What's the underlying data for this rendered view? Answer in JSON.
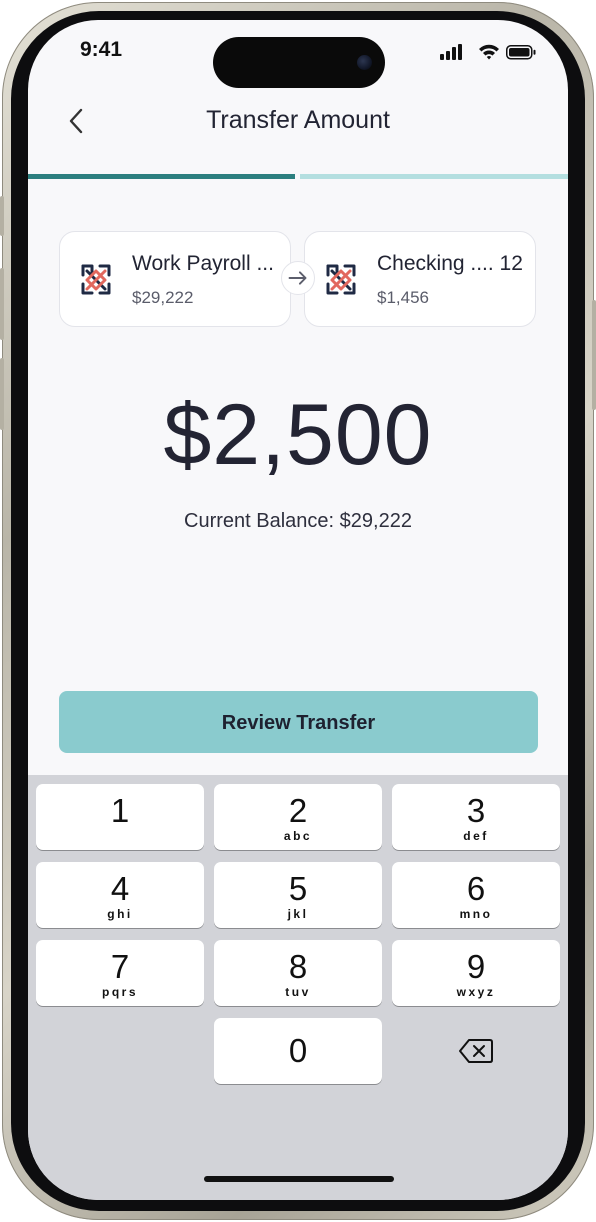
{
  "status_bar": {
    "time": "9:41"
  },
  "header": {
    "title": "Transfer Amount",
    "back_icon": "chevron-left-icon"
  },
  "progress": {
    "step": 1,
    "total_steps": 2
  },
  "accounts": {
    "from": {
      "name": "Work Payroll ...",
      "balance": "$29,222",
      "icon": "bank-logo-icon"
    },
    "to": {
      "name": "Checking .... 12",
      "balance": "$1,456",
      "icon": "bank-logo-icon"
    },
    "arrow_icon": "arrow-right-icon"
  },
  "amount": "$2,500",
  "current_balance": "Current Balance: $29,222",
  "review_button": "Review Transfer",
  "keypad": {
    "keys": [
      {
        "digit": "1",
        "letters": ""
      },
      {
        "digit": "2",
        "letters": "abc"
      },
      {
        "digit": "3",
        "letters": "def"
      },
      {
        "digit": "4",
        "letters": "ghi"
      },
      {
        "digit": "5",
        "letters": "jkl"
      },
      {
        "digit": "6",
        "letters": "mno"
      },
      {
        "digit": "7",
        "letters": "pqrs"
      },
      {
        "digit": "8",
        "letters": "tuv"
      },
      {
        "digit": "9",
        "letters": "wxyz"
      },
      {
        "digit": "0",
        "letters": ""
      }
    ],
    "delete_icon": "backspace-icon"
  },
  "colors": {
    "accent": "#2c7f7f",
    "accent_light": "#b4dfe0",
    "button": "#8acbce",
    "logo_navy": "#1f2a44",
    "logo_coral": "#e2685e"
  }
}
